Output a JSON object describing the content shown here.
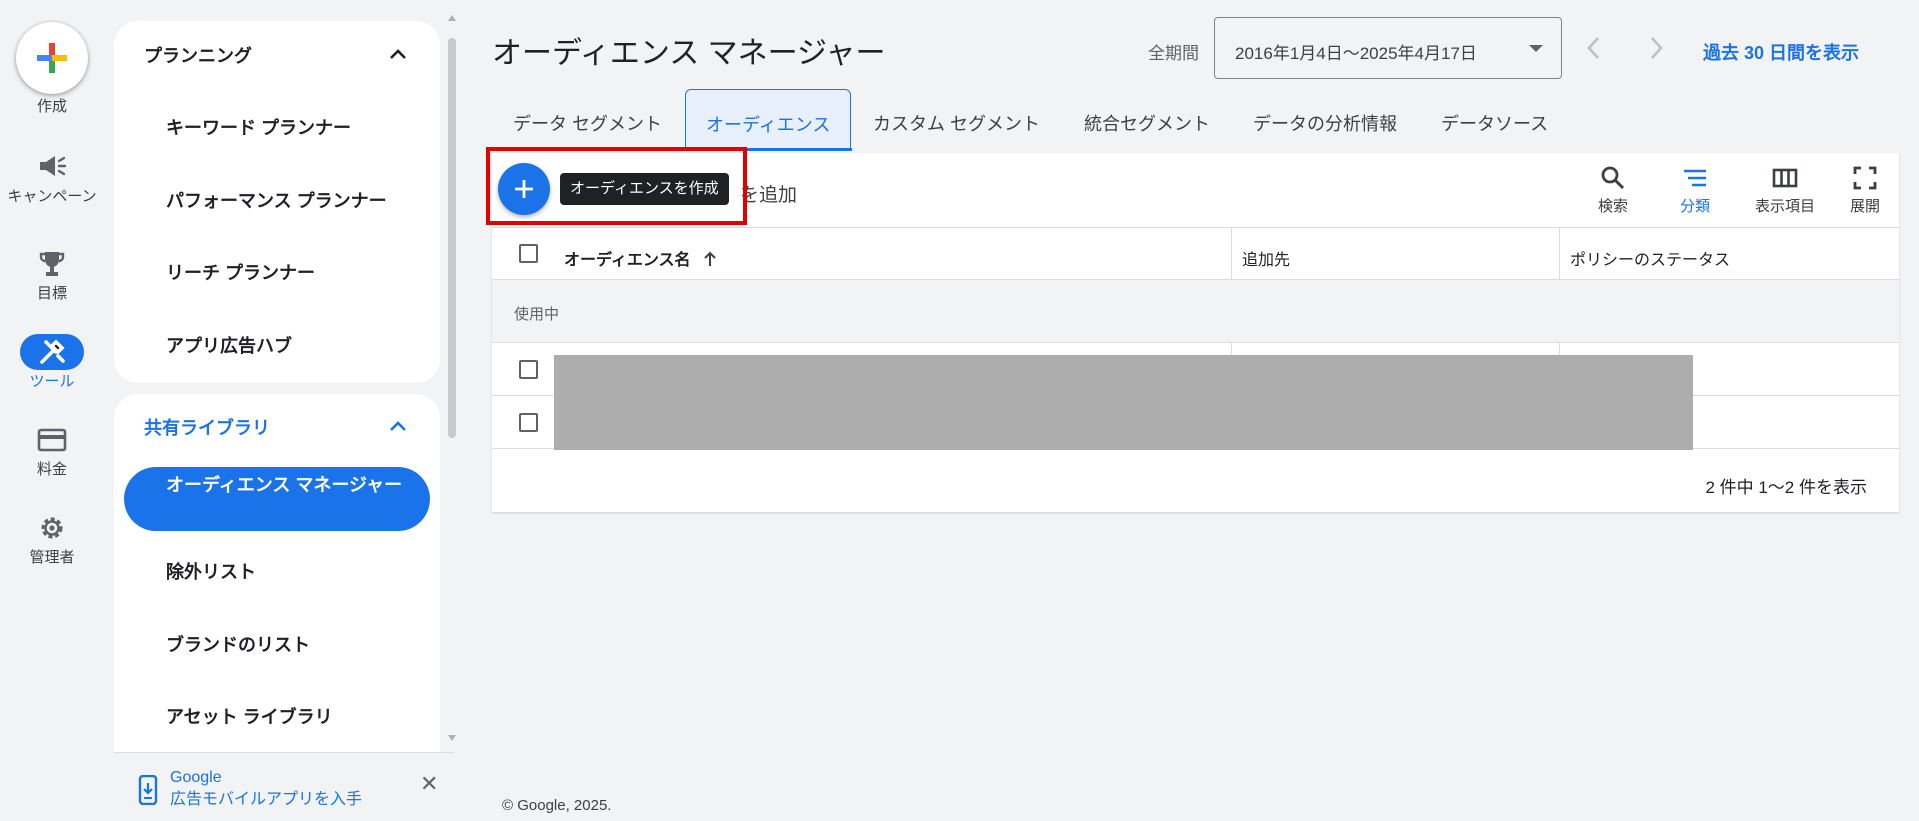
{
  "rail": {
    "create_label": "作成",
    "items": [
      {
        "label": "キャンペーン",
        "icon": "megaphone-icon"
      },
      {
        "label": "目標",
        "icon": "trophy-icon"
      },
      {
        "label": "ツール",
        "icon": "tools-icon",
        "active": true
      },
      {
        "label": "料金",
        "icon": "credit-card-icon"
      },
      {
        "label": "管理者",
        "icon": "gear-icon"
      }
    ]
  },
  "sidenav": {
    "planning": {
      "title": "プランニング",
      "items": [
        "キーワード プランナー",
        "パフォーマンス プランナー",
        "リーチ プランナー",
        "アプリ広告ハブ"
      ]
    },
    "library": {
      "title": "共有ライブラリ",
      "items": [
        "オーディエンス マネージャー",
        "除外リスト",
        "ブランドのリスト",
        "アセット ライブラリ"
      ],
      "active_item": "オーディエンス マネージャー"
    },
    "promo": {
      "line1": "Google",
      "line2": "広告モバイルアプリを入手"
    }
  },
  "header": {
    "title": "オーディエンス マネージャー",
    "period_label": "全期間",
    "date_range": "2016年1月4日〜2025年4月17日",
    "last30_link": "過去 30 日間を表示"
  },
  "tabs": [
    {
      "label": "データ セグメント"
    },
    {
      "label": "オーディエンス",
      "active": true
    },
    {
      "label": "カスタム セグメント"
    },
    {
      "label": "統合セグメント"
    },
    {
      "label": "データの分析情報"
    },
    {
      "label": "データソース"
    }
  ],
  "toolbar": {
    "add_text": "を追加",
    "tooltip": "オーディエンスを作成",
    "tools": [
      {
        "label": "検索",
        "icon": "search-icon"
      },
      {
        "label": "分類",
        "icon": "filter-icon",
        "active": true
      },
      {
        "label": "表示項目",
        "icon": "columns-icon"
      },
      {
        "label": "展開",
        "icon": "fullscreen-icon"
      }
    ]
  },
  "table": {
    "columns": [
      "オーディエンス名",
      "追加先",
      "ポリシーのステータス"
    ],
    "group_label": "使用中",
    "pagination": "2 件中 1〜2 件を表示"
  },
  "footer": "© Google, 2025."
}
